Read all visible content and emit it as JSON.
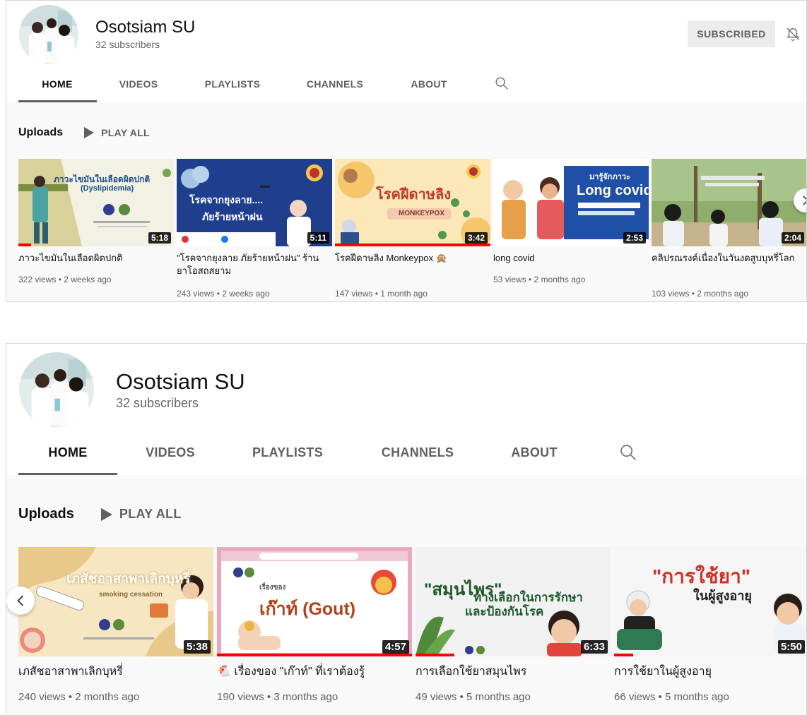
{
  "panel1": {
    "channel_name": "Osotsiam SU",
    "subscribers": "32 subscribers",
    "subscribe_label": "SUBSCRIBED",
    "tabs": [
      "HOME",
      "VIDEOS",
      "PLAYLISTS",
      "CHANNELS",
      "ABOUT"
    ],
    "uploads_label": "Uploads",
    "play_all_label": "PLAY ALL",
    "videos": [
      {
        "title": "ภาวะไขมันในเลือดผิดปกติ",
        "meta": "322 views • 2 weeks ago",
        "duration": "5:18",
        "thumb_text": "ภาวะไขมันในเลือดผิดปกติ",
        "thumb_sub": "(Dyslipidemia)",
        "progress": 0.08
      },
      {
        "title": "\"โรคจากยุงลาย ภัยร้ายหน้าฝน\" ร้านยาโอสถสยาม",
        "meta": "243 views • 2 weeks ago",
        "duration": "5:11",
        "thumb_text": "โรคจากยุงลาย....",
        "thumb_sub": "ภัยร้ายหน้าฝน",
        "progress": 0
      },
      {
        "title": "โรคฝีดาษลิง Monkeypox 🙊",
        "meta": "147 views • 1 month ago",
        "duration": "3:42",
        "thumb_text": "โรคฝีดาษลิง",
        "thumb_sub": "MONKEYPOX",
        "progress": 1.0
      },
      {
        "title": "long covid",
        "meta": "53 views • 2 months ago",
        "duration": "2:53",
        "thumb_text": "Long covid",
        "thumb_sub": "มารู้จักภาวะ",
        "progress": 0
      },
      {
        "title": "คลิปรณรงค์เนื่องในวันงดสูบบุหรี่โลก",
        "meta": "103 views • 2 months ago",
        "duration": "2:04",
        "thumb_text": "",
        "thumb_sub": "",
        "progress": 0
      }
    ]
  },
  "panel2": {
    "channel_name": "Osotsiam SU",
    "subscribers": "32 subscribers",
    "tabs": [
      "HOME",
      "VIDEOS",
      "PLAYLISTS",
      "CHANNELS",
      "ABOUT"
    ],
    "uploads_label": "Uploads",
    "play_all_label": "PLAY ALL",
    "videos": [
      {
        "title": "เภสัชอาสาพาเลิกบุหรี่",
        "meta": "240 views • 2 months ago",
        "duration": "5:38",
        "thumb_text": "เภสัชอาสาพาเลิกบุหรี่",
        "thumb_sub": "smoking cessation",
        "progress": 0
      },
      {
        "title": "🐔 เรื่องของ \"เก๊าท์\" ที่เราต้องรู้",
        "meta": "190 views • 3 months ago",
        "duration": "4:57",
        "thumb_text": "เก๊าท์ (Gout)",
        "thumb_sub": "เรื่องของ",
        "progress": 1.0
      },
      {
        "title": "การเลือกใช้ยาสมุนไพร",
        "meta": "49 views • 5 months ago",
        "duration": "6:33",
        "thumb_text": "\"สมุนไพร\"",
        "thumb_sub": "ทางเลือกในการรักษา",
        "thumb_sub2": "และป้องกันโรค",
        "progress": 0.2
      },
      {
        "title": "การใช้ยาในผู้สูงอายุ",
        "meta": "66 views • 5 months ago",
        "duration": "5:50",
        "thumb_text": "\"การใช้ยา\"",
        "thumb_sub": "ในผู้สูงอายุ",
        "progress": 0.1
      }
    ]
  }
}
